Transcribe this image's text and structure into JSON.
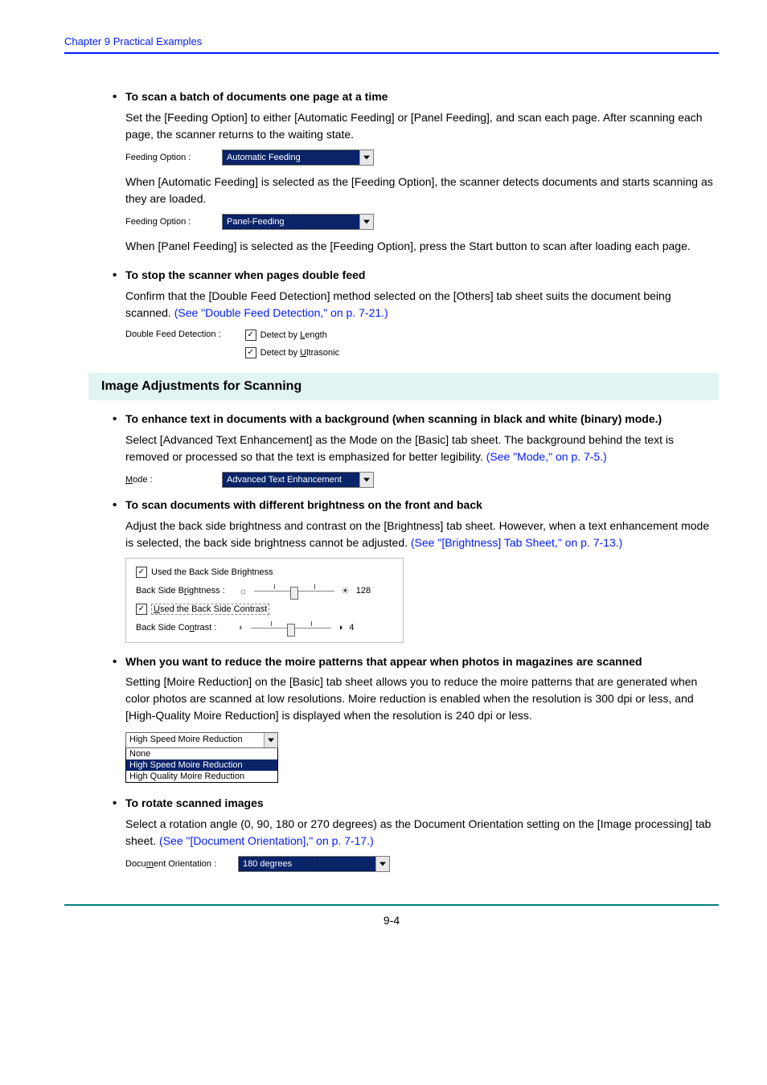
{
  "header": "Chapter 9   Practical Examples",
  "footer": "9-4",
  "s1": {
    "title": "To scan a batch of documents one page at a time",
    "body1": "Set the [Feeding Option] to either [Automatic Feeding] or [Panel Feeding], and scan each page. After scanning each page, the scanner returns to the waiting state.",
    "field1_label": "Feeding Option :",
    "field1_value": "Automatic Feeding",
    "body2": "When [Automatic Feeding] is selected as the [Feeding Option], the scanner detects documents and starts scanning as they are loaded.",
    "field2_label": "Feeding Option :",
    "field2_value": "Panel-Feeding",
    "body3": "When [Panel Feeding] is selected as the [Feeding Option], press the Start button to scan after loading each page."
  },
  "s2": {
    "title": "To stop the scanner when pages double feed",
    "body1a": "Confirm that the [Double Feed Detection] method selected on the [Others] tab sheet suits the document being scanned. ",
    "link": "(See \"Double Feed Detection,\" on p. 7-21.)",
    "dfd_label": "Double Feed Detection :",
    "chk1_pre": "Detect by ",
    "chk1_u": "L",
    "chk1_post": "ength",
    "chk2_pre": "Detect by ",
    "chk2_u": "U",
    "chk2_post": "ltrasonic"
  },
  "band": "Image Adjustments for Scanning",
  "s3": {
    "title": "To enhance text in documents with a background (when scanning in black and white (binary) mode.)",
    "body1a": "Select [Advanced Text Enhancement] as the Mode on the [Basic] tab sheet. The background behind the text is removed or processed so that the text is emphasized for better legibility. ",
    "link": "(See \"Mode,\" on p. 7-5.)",
    "mode_label_u": "M",
    "mode_label_post": "ode :",
    "mode_value": "Advanced Text Enhancement"
  },
  "s4": {
    "title": "To scan documents with different brightness on the front and back",
    "body1a": "Adjust the back side brightness and contrast on the [Brightness] tab sheet. However, when a text enhancement mode is selected, the back side brightness cannot be adjusted. ",
    "link": "(See \"[Brightness] Tab Sheet,\" on p. 7-13.)",
    "chk_bright": "Used the Back Side Brightness",
    "lbl_bright_pre": "Back Side B",
    "lbl_bright_u": "r",
    "lbl_bright_post": "ightness :",
    "val_bright": "128",
    "chk_contrast_u": "U",
    "chk_contrast_post": "sed the Back Side Contrast",
    "lbl_contrast_pre": "Back Side Co",
    "lbl_contrast_u": "n",
    "lbl_contrast_post": "trast :",
    "val_contrast": "4"
  },
  "s5": {
    "title": "When you want to reduce the moire patterns that appear when photos in magazines are scanned",
    "body1": "Setting [Moire Reduction] on the [Basic] tab sheet allows you to reduce the moire patterns that are generated when color photos are scanned at low resolutions. Moire reduction is enabled when the resolution is 300 dpi or less, and [High-Quality Moire Reduction] is displayed when the resolution is 240 dpi or less.",
    "combo_sel": "High Speed Moire Reduction",
    "opt_none": "None",
    "opt_hs": "High Speed Moire Reduction",
    "opt_hq": "High Quality Moire Reduction"
  },
  "s6": {
    "title": "To rotate scanned images",
    "body1a": "Select a rotation angle (0, 90, 180 or 270 degrees) as the Document Orientation setting on the [Image processing] tab sheet. ",
    "link": "(See \"[Document Orientation],\" on p. 7-17.)",
    "orient_label_pre": "Docu",
    "orient_label_u": "m",
    "orient_label_post": "ent Orientation :",
    "orient_value": "180 degrees"
  }
}
